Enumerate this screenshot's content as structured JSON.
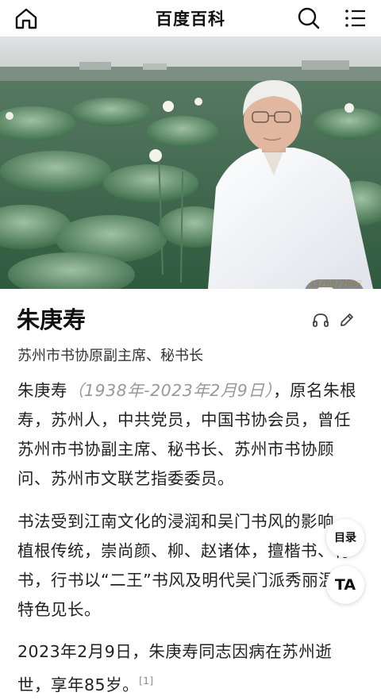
{
  "header": {
    "title": "百度百科",
    "home_icon": "home-icon",
    "search_icon": "search-icon",
    "menu_icon": "menu-list-icon"
  },
  "hero": {
    "gallery_count": "1",
    "gallery_icon": "image-gallery-icon"
  },
  "entry": {
    "name": "朱庚寿",
    "subtitle": "苏州市书协原副主席、秘书长",
    "listen_icon": "headphones-icon",
    "edit_icon": "pencil-edit-icon"
  },
  "content": {
    "p1_lead": "朱庚寿",
    "p1_dates": "（1938年-2023年2月9日）",
    "p1_rest": "，原名朱根寿，苏州人，中共党员，中国书协会员，曾任苏州市书协副主席、秘书长、苏州市书协顾问、苏州市文联艺指委委员。",
    "p2": "书法受到江南文化的浸润和吴门书风的影响，植根传统，崇尚颜、柳、赵诸体，擅楷书、行书，行书以“二王”书风及明代吴门派秀丽温润特色见长。",
    "p3": "2023年2月9日，朱庚寿同志因病在苏州逝世，享年85岁。",
    "p3_ref": "[1]"
  },
  "floating": {
    "toc_label": "目录",
    "ta_label": "TA"
  },
  "colors": {
    "primary_text": "#222222",
    "secondary_text": "#999999",
    "background": "#ffffff"
  }
}
